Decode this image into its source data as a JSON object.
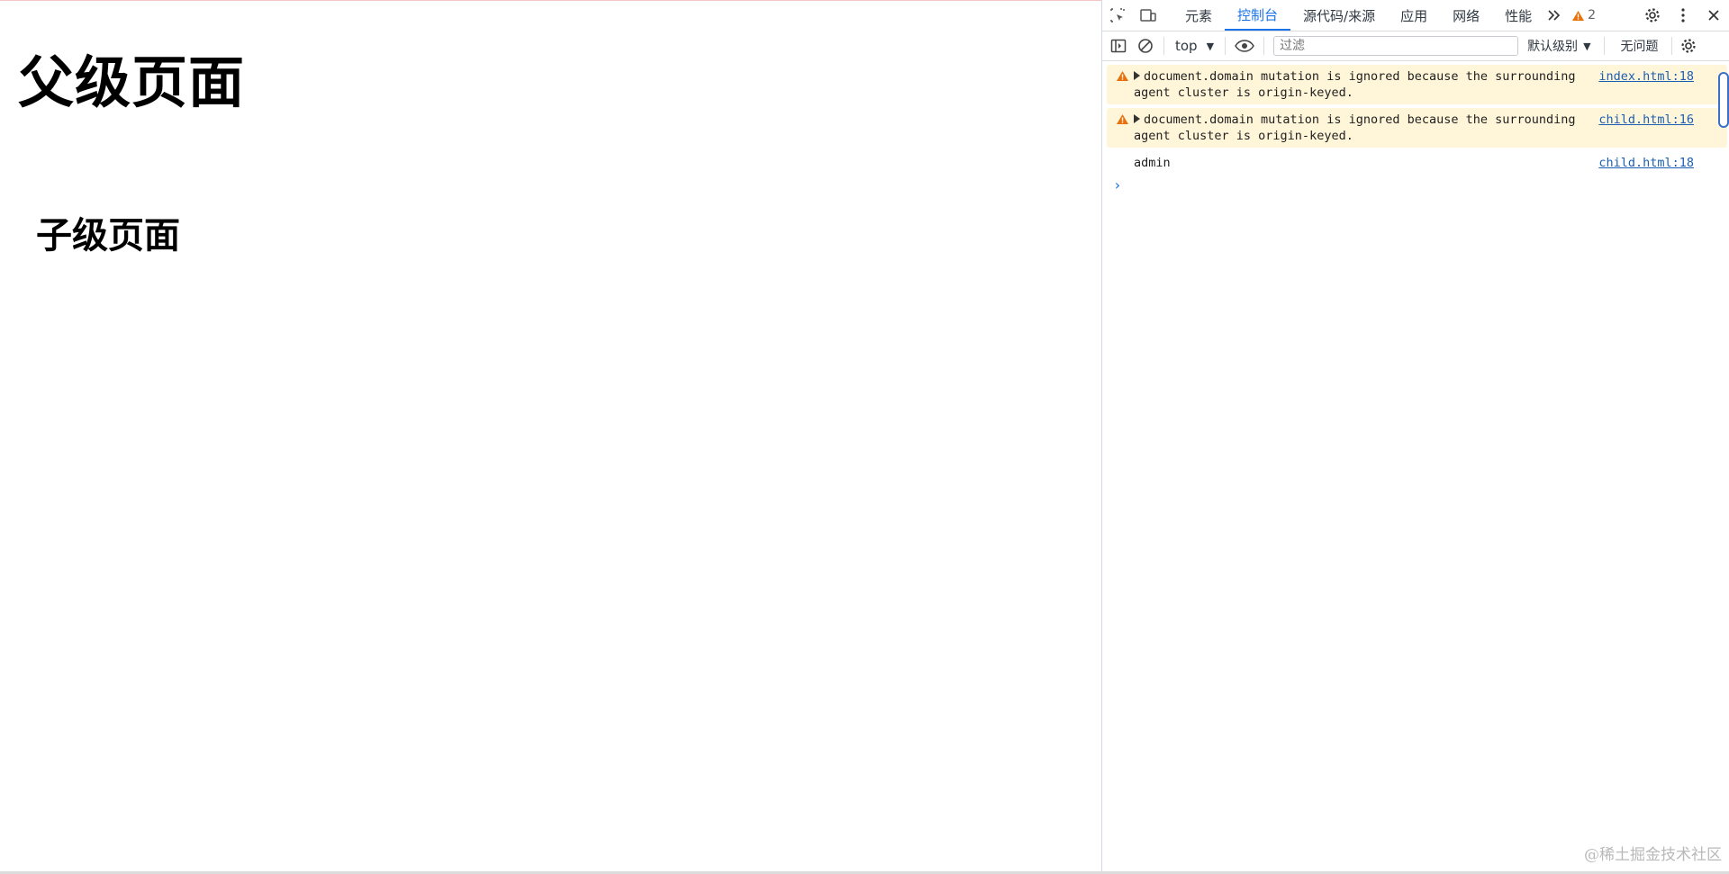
{
  "page": {
    "title": "父级页面",
    "child_title": "子级页面"
  },
  "devtools": {
    "tabs": [
      {
        "label": "元素"
      },
      {
        "label": "控制台"
      },
      {
        "label": "源代码/来源"
      },
      {
        "label": "应用"
      },
      {
        "label": "网络"
      },
      {
        "label": "性能"
      }
    ],
    "issues_count": "2",
    "context": "top",
    "filter_placeholder": "过滤",
    "level": "默认级别",
    "issues_label": "无问题",
    "messages": [
      {
        "type": "warning",
        "text": "document.domain mutation is ignored because the surrounding agent cluster is origin-keyed.",
        "source": "index.html:18"
      },
      {
        "type": "warning",
        "text": "document.domain mutation is ignored because the surrounding agent cluster is origin-keyed.",
        "source": "child.html:16"
      },
      {
        "type": "log",
        "text": "admin",
        "source": "child.html:18"
      }
    ],
    "prompt": "›"
  },
  "watermark": "@稀土掘金技术社区",
  "colors": {
    "accent": "#1a73e8",
    "warning_bg": "#fff5d9",
    "warning_icon": "#e8710a"
  }
}
